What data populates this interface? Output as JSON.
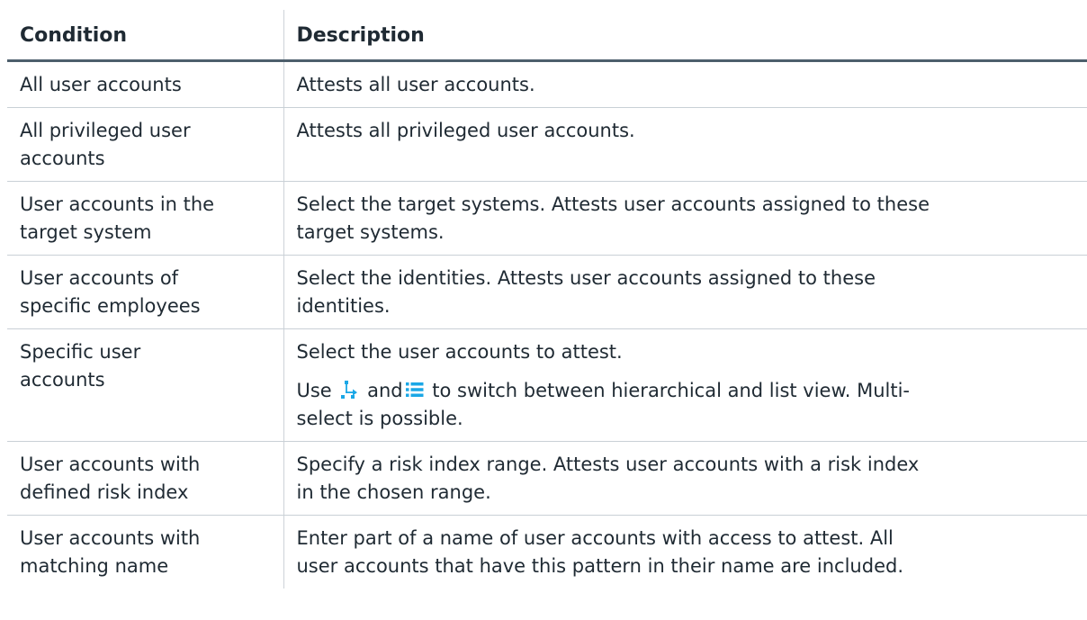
{
  "table": {
    "headers": {
      "condition": "Condition",
      "description": "Description"
    },
    "rows": [
      {
        "condition": "All user accounts",
        "description": "Attests all user accounts."
      },
      {
        "condition": "All privileged user accounts",
        "description": "Attests all privileged user accounts."
      },
      {
        "condition": "User accounts in the target system",
        "description": "Select the target systems. Attests user accounts assigned to these target systems."
      },
      {
        "condition": "User accounts of specific employees",
        "description": "Select the identities. Attests user accounts assigned to these identities."
      },
      {
        "condition": "Specific user accounts",
        "description": "Select the user accounts to attest.",
        "note": {
          "prefix": "Use",
          "middle": "and",
          "suffix": "to switch between hierarchical and list view. Multi-",
          "suffix_line2": "select is possible.",
          "icons": [
            "hierarchy-icon",
            "list-icon"
          ]
        }
      },
      {
        "condition": "User accounts with defined risk index",
        "description": "Specify a risk index range.  Attests user accounts with a risk index in the chosen range."
      },
      {
        "condition": "User accounts with matching name",
        "description": "Enter part of a name of user accounts with access to attest. All user accounts that have this pattern in their name are included."
      }
    ]
  },
  "colors": {
    "icon": "#1aa7e6",
    "header_rule": "#4d5f6c",
    "row_rule": "#c9d0d6",
    "text": "#1f2a33"
  }
}
